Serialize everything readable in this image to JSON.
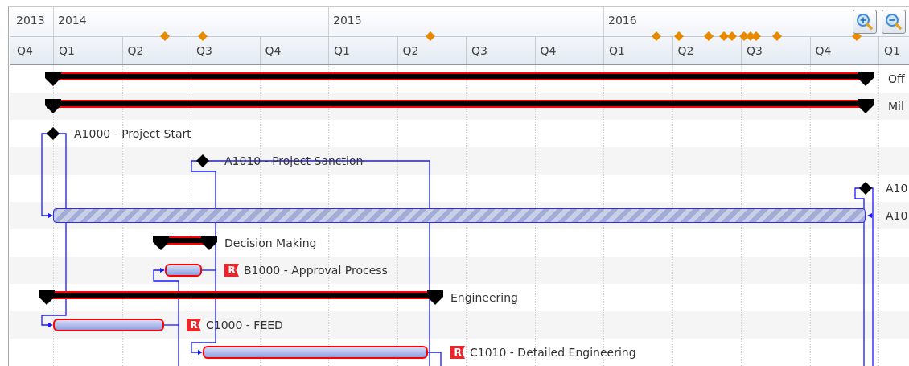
{
  "timeline": {
    "years": [
      "2013",
      "2014",
      "2015",
      "2016"
    ],
    "quarters": [
      "Q4",
      "Q1",
      "Q2",
      "Q3",
      "Q4",
      "Q1",
      "Q2",
      "Q3",
      "Q4",
      "Q1",
      "Q2",
      "Q3",
      "Q4",
      "Q1"
    ]
  },
  "rows": [
    {
      "kind": "summary",
      "label": "Off"
    },
    {
      "kind": "summary",
      "label": "Mil"
    },
    {
      "kind": "milestone",
      "label": "A1000 - Project Start"
    },
    {
      "kind": "milestone",
      "label": "A1010 - Project Sanction"
    },
    {
      "kind": "milestone",
      "label": "A10"
    },
    {
      "kind": "hatched",
      "label": "A10"
    },
    {
      "kind": "summary",
      "label": "Decision Making"
    },
    {
      "kind": "task",
      "flag": "R",
      "label": "B1000 - Approval Process"
    },
    {
      "kind": "summary",
      "label": "Engineering"
    },
    {
      "kind": "task",
      "flag": "R",
      "label": "C1000 - FEED"
    },
    {
      "kind": "task",
      "flag": "R",
      "label": "C1010 - Detailed Engineering"
    }
  ]
}
